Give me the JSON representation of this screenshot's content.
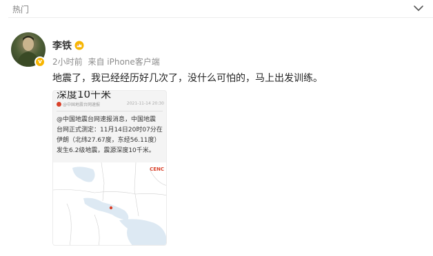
{
  "header": {
    "tab_label": "热门"
  },
  "post": {
    "author": {
      "name": "李铁",
      "avatar_badge": "v"
    },
    "meta": {
      "time": "2小时前",
      "source": "来自 iPhone客户端"
    },
    "text": "地震了，我已经经历好几次了，没什么可怕的，马上出发训练。",
    "attached_image": {
      "heading": "深度10千米",
      "source_label": "@中国地震台网速报",
      "date": "2021-11-14 20:30",
      "body_lines": [
        "@中国地震台网速报消息，中国地震",
        "台网正式测定：11月14日20时07分在",
        "伊朗（北纬27.67度，东经56.11度）",
        "发生6.2级地震，震源深度10千米。"
      ],
      "map_logo": "CENC"
    }
  },
  "colors": {
    "accent_orange": "#f7b500",
    "cenc_red": "#d9412a",
    "map_water": "#dde9f3",
    "map_land": "#ffffff"
  },
  "icons": {
    "collapse": "chevron-down-icon",
    "vip": "vip-crown-icon"
  }
}
